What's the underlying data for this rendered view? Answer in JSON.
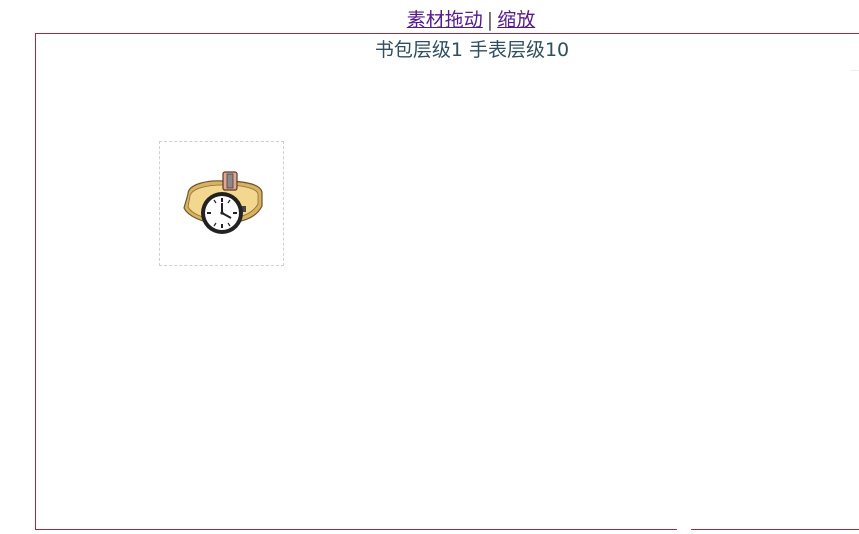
{
  "nav": {
    "link_drag": "素材拖动",
    "separator": "|",
    "link_zoom": "缩放"
  },
  "stage": {
    "title": "书包层级1 手表层级10"
  },
  "items": [
    {
      "name": "watch",
      "icon": "watch-icon"
    }
  ],
  "colors": {
    "stage_border": "#a52a3a",
    "link": "#551a8b",
    "title_text": "#2f4f5f",
    "item_border": "#cfcfcf"
  }
}
